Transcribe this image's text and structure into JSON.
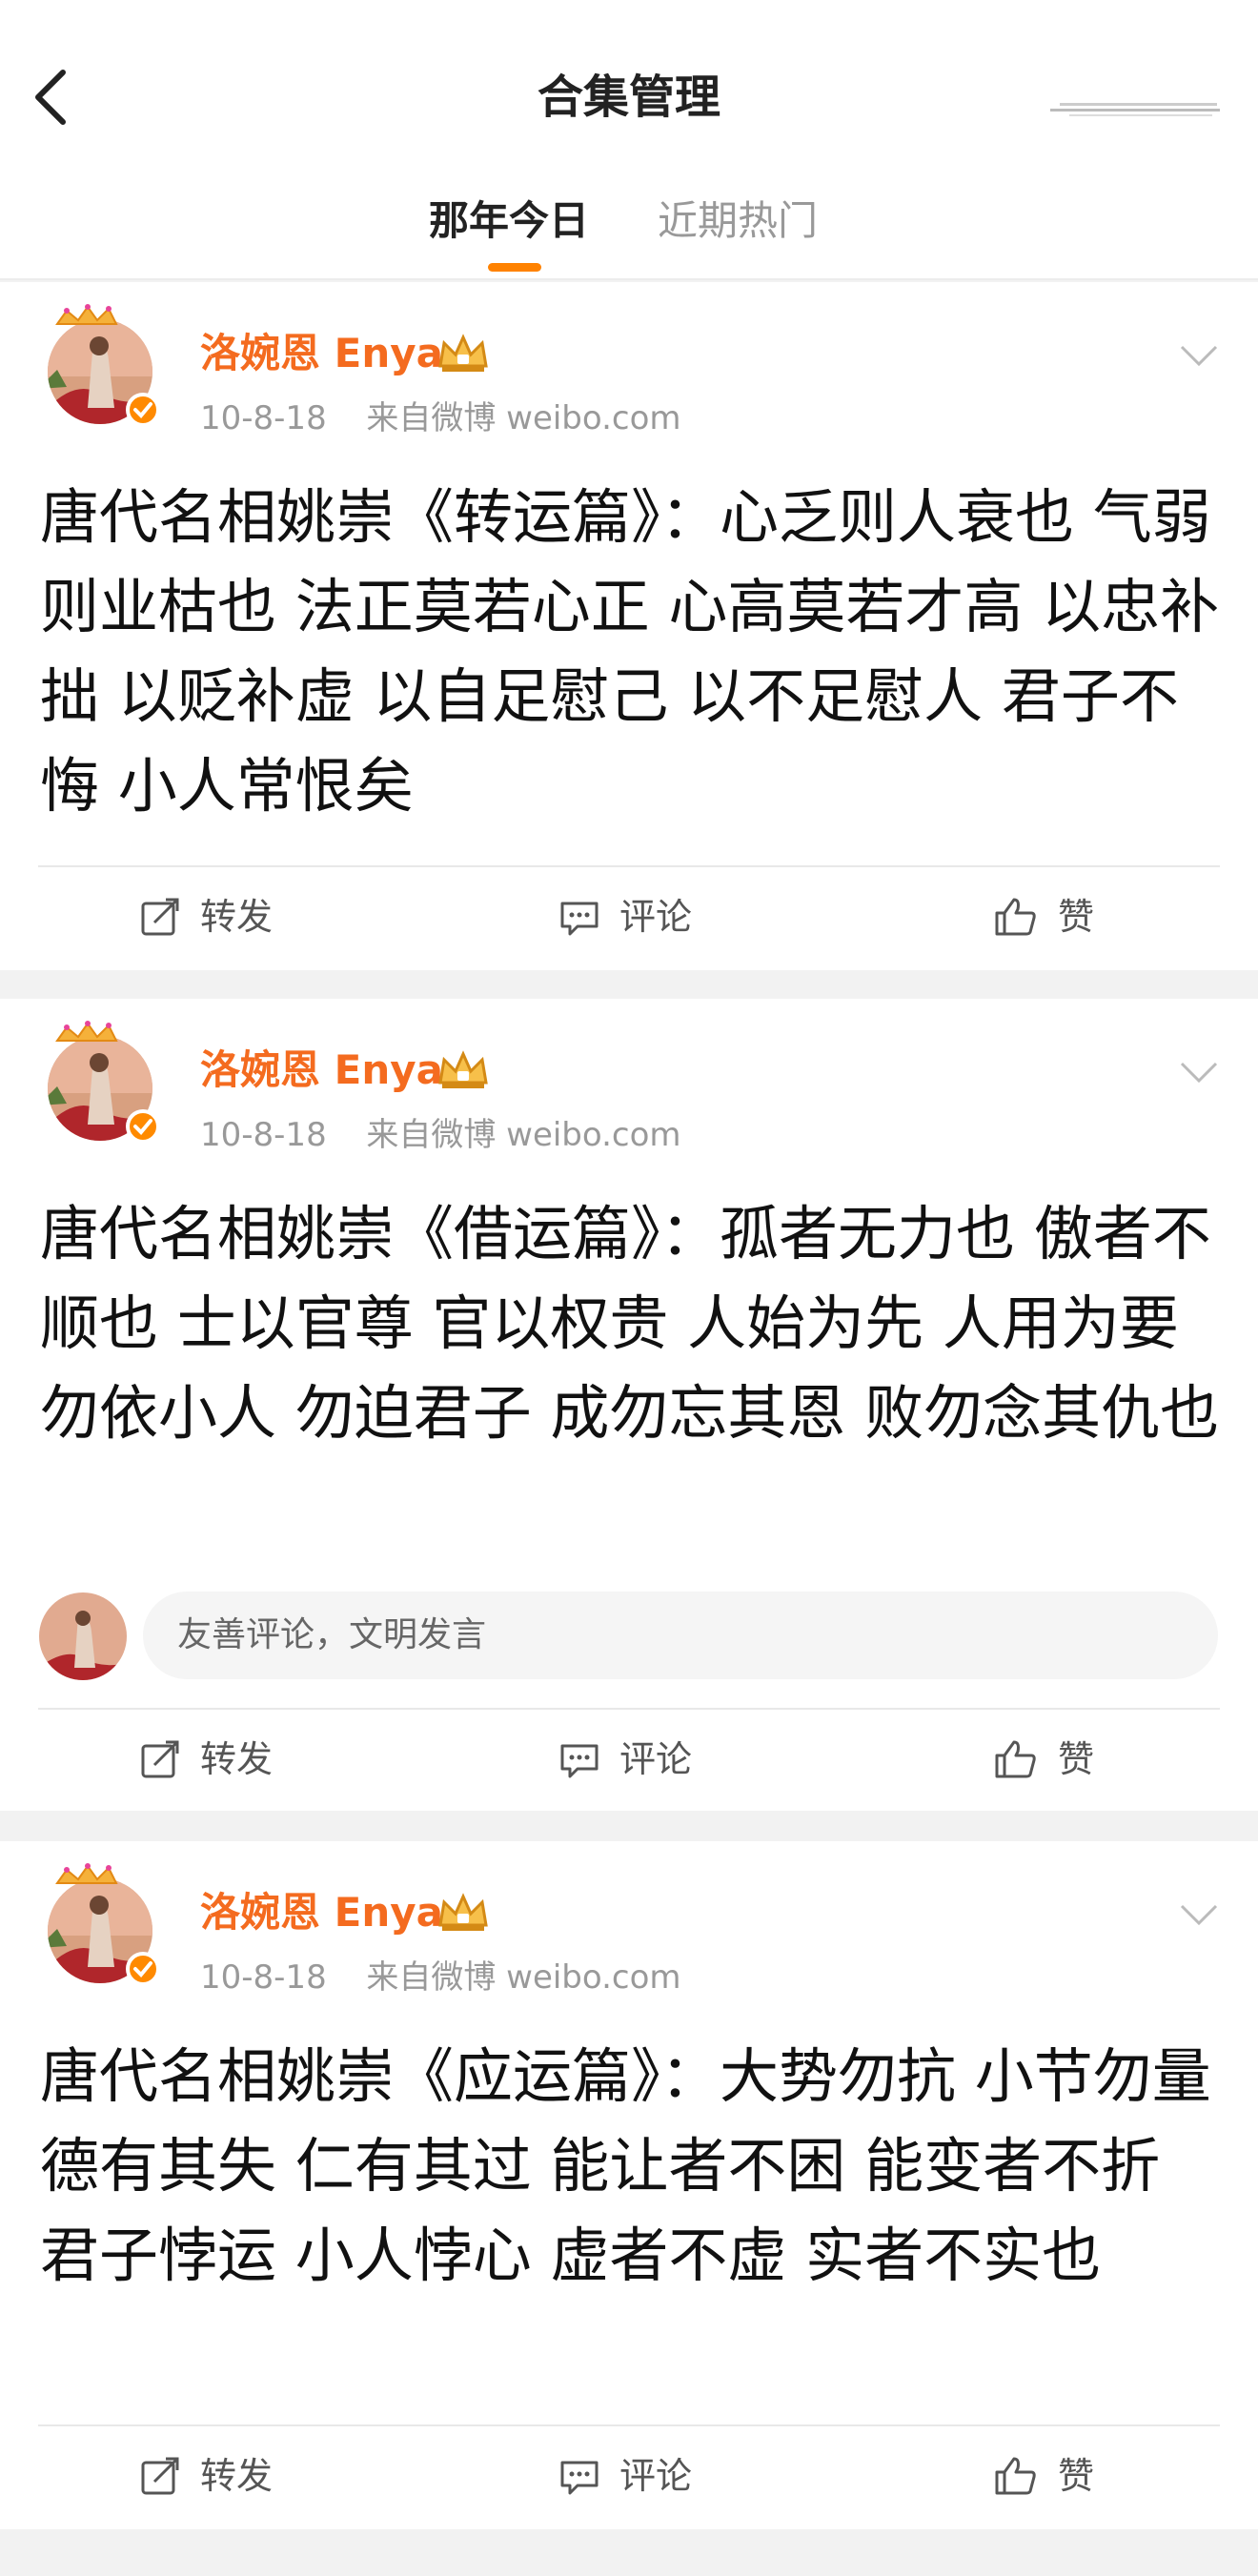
{
  "header": {
    "title": "合集管理"
  },
  "tabs": [
    {
      "label": "那年今日",
      "active": true
    },
    {
      "label": "近期热门",
      "active": false
    }
  ],
  "accent_color": "#ff8200",
  "username_color": "#f46b1f",
  "posts": [
    {
      "username": "洛婉恩 Enya",
      "date": "10-8-18",
      "source": "来自微博 weibo.com",
      "text": "唐代名相姚崇《转运篇》：心乏则人衰也 气弱则业枯也 法正莫若心正 心高莫若才高 以忠补拙 以贬补虚 以自足慰己 以不足慰人 君子不悔 小人常恨矣"
    },
    {
      "username": "洛婉恩 Enya",
      "date": "10-8-18",
      "source": "来自微博 weibo.com",
      "text": "唐代名相姚崇《借运篇》：孤者无力也 傲者不顺也 士以官尊 官以权贵 人始为先 人用为要 勿依小人 勿迫君子 成勿忘其恩 败勿念其仇也",
      "comment_placeholder": "友善评论，文明发言"
    },
    {
      "username": "洛婉恩 Enya",
      "date": "10-8-18",
      "source": "来自微博 weibo.com",
      "text": "唐代名相姚崇《应运篇》：大势勿抗 小节勿量 德有其失 仁有其过 能让者不困 能变者不折 君子悖运 小人悖心 虚者不虚 实者不实也"
    }
  ],
  "actions": {
    "repost": "转发",
    "comment": "评论",
    "like": "赞"
  }
}
